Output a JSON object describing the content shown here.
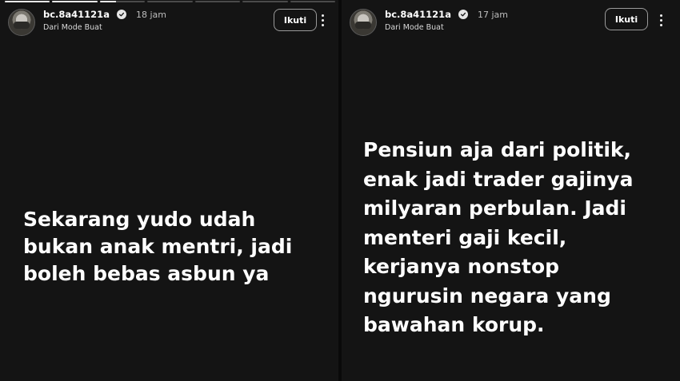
{
  "stories": [
    {
      "username": "bc.8a41121a",
      "time": "18 jam",
      "subtitle": "Dari Mode Buat",
      "follow_label": "Ikuti",
      "text": "Sekarang yudo udah\nbukan anak mentri, jadi\nboleh bebas asbun ya",
      "progress_segments": [
        1,
        1,
        0.35,
        0,
        0,
        0,
        0
      ]
    },
    {
      "username": "bc.8a41121a",
      "time": "17 jam",
      "subtitle": "Dari Mode Buat",
      "follow_label": "Ikuti",
      "text": "Pensiun aja dari politik,\nenak jadi trader gajinya\nmilyaran perbulan. Jadi\nmenteri gaji kecil,\nkerjanya nonstop\nngurusin negara yang\nbawahan korup."
    }
  ],
  "icons": {
    "verified": "verified-badge-icon",
    "more": "vertical-ellipsis-icon"
  }
}
